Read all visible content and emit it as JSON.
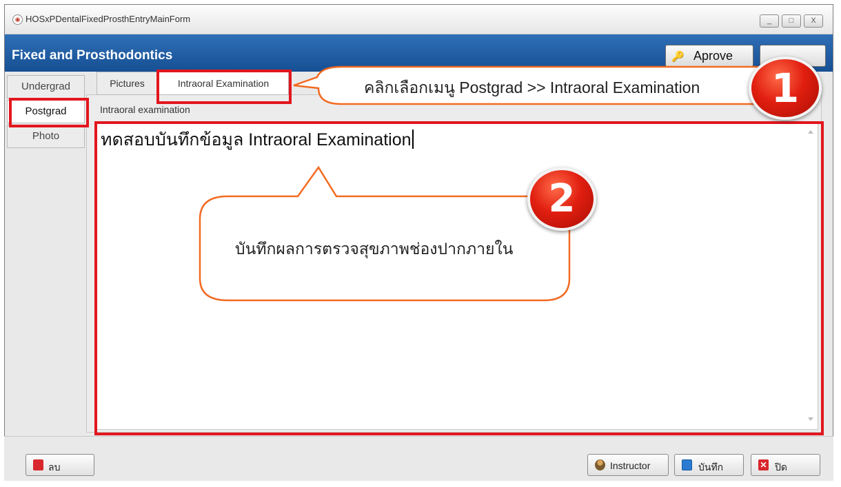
{
  "window": {
    "title": "HOSxPDentalFixedProsthEntryMainForm",
    "buttons": [
      "_",
      "□",
      "X"
    ]
  },
  "header": {
    "title": "Fixed and Prosthodontics",
    "approve_label": "Aprove"
  },
  "side_tabs": [
    {
      "label": "Undergrad",
      "active": false
    },
    {
      "label": "Postgrad",
      "active": true
    },
    {
      "label": "Photo",
      "active": false
    }
  ],
  "top_tabs": [
    {
      "label": "Pictures",
      "active": false
    },
    {
      "label": "Intraoral Examination",
      "active": true
    }
  ],
  "group_label": "Intraoral examination",
  "memo": {
    "value": "ทดสอบบันทึกข้อมูล Intraoral Examination"
  },
  "callouts": [
    {
      "number": "1",
      "text": "คลิกเลือกเมนู Postgrad >> Intraoral Examination"
    },
    {
      "number": "2",
      "text": "บันทึกผลการตรวจสุขภาพช่องปากภายใน"
    }
  ],
  "footer": {
    "delete_label": "ลบ",
    "instructor_label": "Instructor",
    "save_label": "บันทึก",
    "close_label": "ปิด"
  },
  "colors": {
    "header_blue": "#1f5ea8",
    "highlight_red": "#e2161e",
    "callout_orange": "#f26a21",
    "badge_red": "#e11f10"
  }
}
